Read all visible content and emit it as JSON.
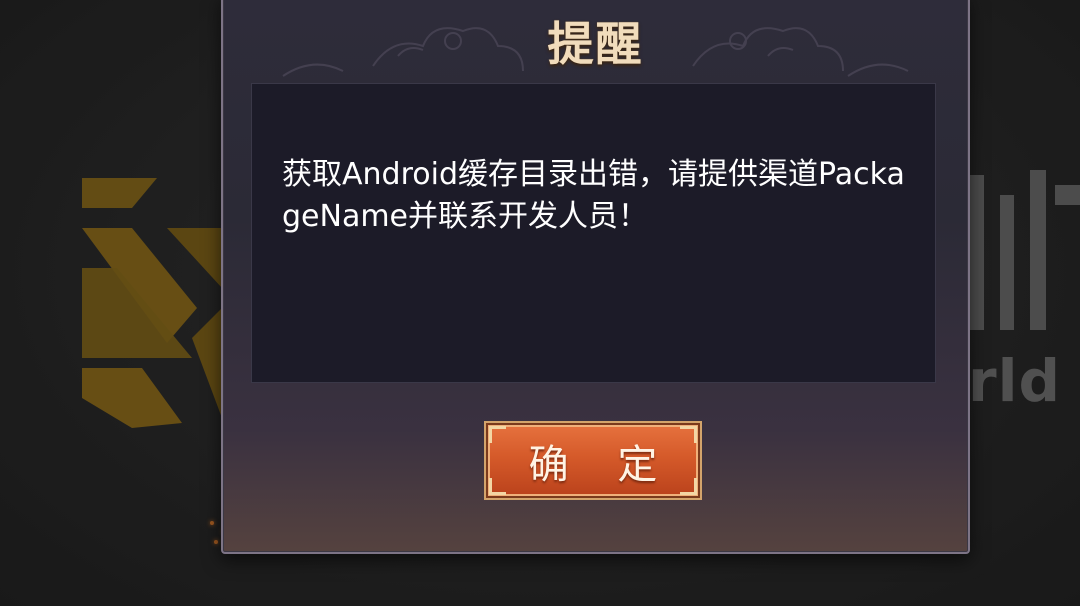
{
  "background": {
    "logo_text": "rld"
  },
  "dialog": {
    "title": "提醒",
    "message": "获取Android缓存目录出错，请提供渠道PackageName并联系开发人员！",
    "confirm_label": "确 定"
  },
  "colors": {
    "title": "#f1dcbc",
    "message": "#ffffff",
    "button": "#d55a2a",
    "logo_gold": "#b3861a"
  }
}
